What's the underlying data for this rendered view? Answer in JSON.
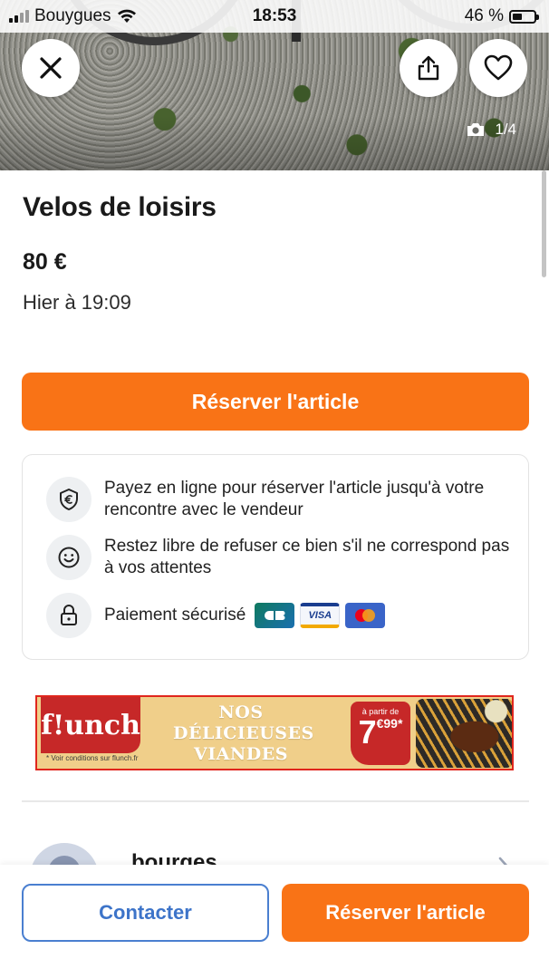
{
  "status_bar": {
    "carrier": "Bouygues",
    "time": "18:53",
    "battery": "46 %",
    "battery_level": 0.46
  },
  "photo": {
    "counter": "1/4"
  },
  "listing": {
    "title": "Velos de loisirs",
    "price": "80 €",
    "date": "Hier à 19:09"
  },
  "actions": {
    "reserve_label": "Réserver l'article",
    "contact_label": "Contacter"
  },
  "info": {
    "pay_online": "Payez en ligne pour réserver l'article jusqu'à votre rencontre avec le vendeur",
    "free_refuse": "Restez libre de refuser ce bien s'il ne correspond pas à vos attentes",
    "secure_payment": "Paiement sécurisé",
    "card_visa": "VISA"
  },
  "ad": {
    "brand": "f!unch",
    "slogan": "NOS DÉLICIEUSES VIANDES",
    "price_prefix": "à partir de",
    "price_main": "7",
    "price_cents": "€99*",
    "conditions": "* Voir conditions sur flunch.fr"
  },
  "seller": {
    "name": "bourges"
  },
  "colors": {
    "accent_orange": "#f97316",
    "contact_blue": "#3d74c9",
    "ad_red": "#c62828"
  }
}
